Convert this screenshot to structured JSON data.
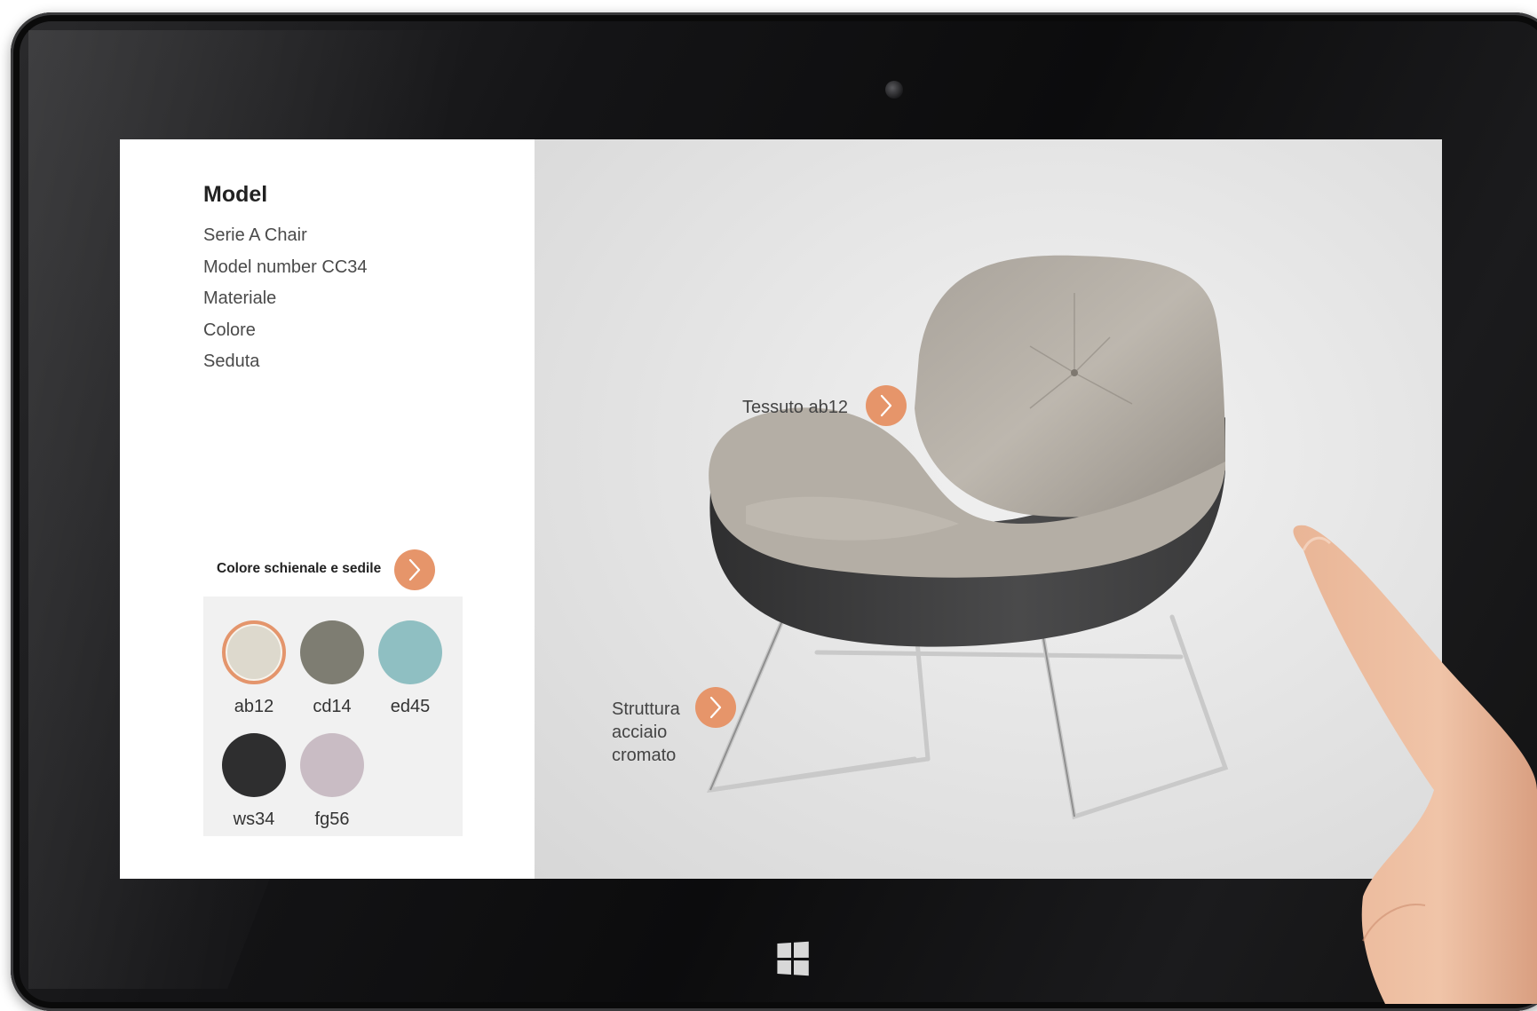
{
  "sidebar": {
    "title": "Model",
    "lines": [
      "Serie A Chair",
      "Model number CC34",
      "Materiale",
      "Colore",
      "Seduta"
    ]
  },
  "color_picker": {
    "label": "Colore schienale e sedile",
    "swatches": [
      {
        "code": "ab12",
        "color": "#ddd9cd",
        "selected": true
      },
      {
        "code": "cd14",
        "color": "#7e7d72"
      },
      {
        "code": "ed45",
        "color": "#8fbfc2"
      },
      {
        "code": "ws34",
        "color": "#2e2e2f"
      },
      {
        "code": "fg56",
        "color": "#c9bcc4"
      }
    ]
  },
  "hotspots": {
    "fabric": "Tessuto ab12",
    "structure": "Struttura\nacciaio\ncromato"
  },
  "colors": {
    "accent": "#e6956a",
    "bezel": "#151517"
  },
  "icons": {
    "chevron": "chevron-right-icon",
    "windows": "windows-logo-icon",
    "camera": "camera-icon"
  }
}
